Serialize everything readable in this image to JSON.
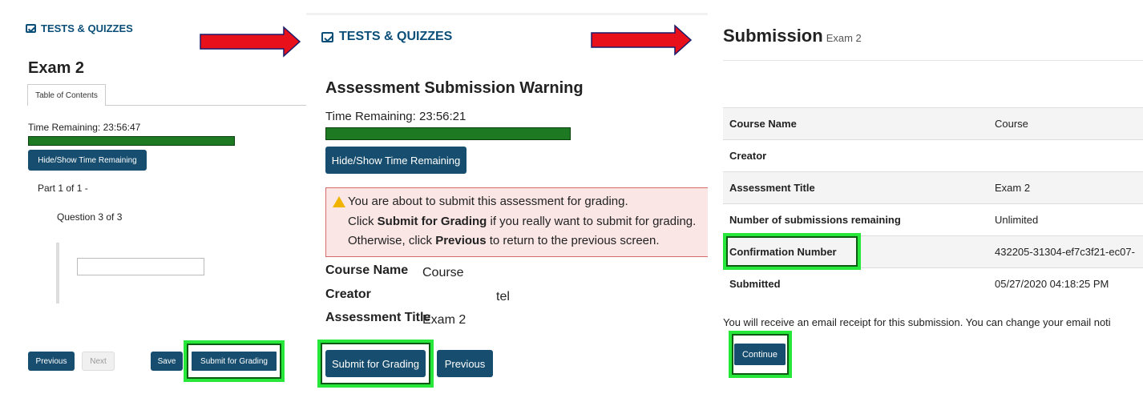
{
  "panel1": {
    "brand": "TESTS & QUIZZES",
    "exam_title": "Exam 2",
    "toc_tab": "Table of Contents",
    "time_remaining": "Time Remaining: 23:56:47",
    "timer_progress": 1.0,
    "hide_show_button": "Hide/Show Time Remaining",
    "part": "Part 1 of 1 -",
    "question": "Question 3 of 3",
    "answer_value": "",
    "buttons": {
      "previous": "Previous",
      "next": "Next",
      "save": "Save",
      "submit": "Submit for Grading"
    }
  },
  "panel2": {
    "brand": "TESTS & QUIZZES",
    "heading": "Assessment Submission Warning",
    "time_remaining": "Time Remaining: 23:56:21",
    "timer_progress": 1.0,
    "hide_show_button": "Hide/Show Time Remaining",
    "warning": {
      "line1": "You are about to submit this assessment for grading.",
      "line2_pre": "Click ",
      "line2_bold": "Submit for Grading",
      "line2_post": " if you really want to submit for grading.",
      "line3_pre": "Otherwise, click ",
      "line3_bold": "Previous",
      "line3_post": " to return to the previous screen."
    },
    "course_name_label": "Course Name",
    "course_name_value": "Course",
    "creator_label": "Creator",
    "creator_value": "tel",
    "assessment_title_label": "Assessment Title",
    "assessment_title_value": "Exam 2",
    "buttons": {
      "submit": "Submit for Grading",
      "previous": "Previous"
    }
  },
  "panel3": {
    "title": "Submission",
    "subtitle": "Exam 2",
    "rows": [
      {
        "label": "Course Name",
        "value": "Course"
      },
      {
        "label": "Creator",
        "value": ""
      },
      {
        "label": "Assessment Title",
        "value": "Exam 2"
      },
      {
        "label": "Number of submissions remaining",
        "value": "Unlimited"
      },
      {
        "label": "Confirmation Number",
        "value": "432205-31304-ef7c3f21-ec07-"
      },
      {
        "label": "Submitted",
        "value": "05/27/2020 04:18:25 PM"
      }
    ],
    "email_note": "You will receive an email receipt for this submission. You can change your email noti",
    "continue_button": "Continue"
  },
  "colors": {
    "brand": "#0b4f79",
    "button": "#174e6f",
    "highlight": "#27e83a",
    "timer_bar": "#1d7a22",
    "arrow": "#e8101a",
    "warning_bg": "#fbe6e6"
  }
}
